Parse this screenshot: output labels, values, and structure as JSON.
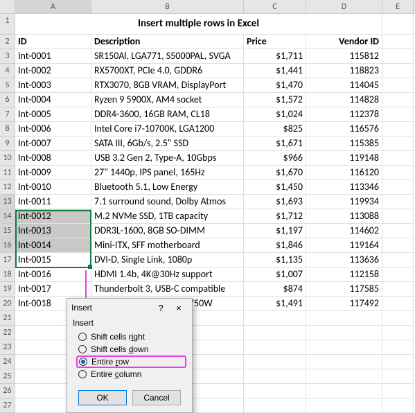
{
  "columns": [
    "A",
    "B",
    "C",
    "D",
    "E"
  ],
  "title": "Insert multiple rows in Excel",
  "headers": {
    "id": "ID",
    "desc": "Description",
    "price": "Price",
    "vendor": "Vendor ID"
  },
  "rows": [
    {
      "n": 3,
      "id": "Int-0001",
      "desc": "SR150Al, LGA771, S5000PAL, SVGA",
      "price": "$1,711",
      "vendor": "115812"
    },
    {
      "n": 4,
      "id": "Int-0002",
      "desc": "RX5700XT, PCIe 4.0, GDDR6",
      "price": "$1,441",
      "vendor": "118823"
    },
    {
      "n": 5,
      "id": "Int-0003",
      "desc": "RTX3070, 8GB VRAM, DisplayPort",
      "price": "$1,470",
      "vendor": "114045"
    },
    {
      "n": 6,
      "id": "Int-0004",
      "desc": "Ryzen 9 5900X, AM4 socket",
      "price": "$1,572",
      "vendor": "114828"
    },
    {
      "n": 7,
      "id": "Int-0005",
      "desc": "DDR4-3600, 16GB RAM, CL18",
      "price": "$1,024",
      "vendor": "112378"
    },
    {
      "n": 8,
      "id": "Int-0006",
      "desc": "Intel Core i7-10700K, LGA1200",
      "price": "$825",
      "vendor": "116576"
    },
    {
      "n": 9,
      "id": "Int-0007",
      "desc": "SATA III, 6Gb/s, 2.5\" SSD",
      "price": "$1,671",
      "vendor": "115385"
    },
    {
      "n": 10,
      "id": "Int-0008",
      "desc": "USB 3.2 Gen 2, Type-A, 10Gbps",
      "price": "$966",
      "vendor": "119148"
    },
    {
      "n": 11,
      "id": "Int-0009",
      "desc": "27\" 1440p, IPS panel, 165Hz",
      "price": "$1,670",
      "vendor": "116120"
    },
    {
      "n": 12,
      "id": "Int-0010",
      "desc": "Bluetooth 5.1, Low Energy",
      "price": "$1,450",
      "vendor": "113346"
    },
    {
      "n": 13,
      "id": "Int-0011",
      "desc": "7.1 surround sound, Dolby Atmos",
      "price": "$1,693",
      "vendor": "119934",
      "sel": true,
      "first": true
    },
    {
      "n": 14,
      "id": "Int-0012",
      "desc": "M.2 NVMe SSD, 1TB capacity",
      "price": "$1,712",
      "vendor": "113088",
      "sel": true
    },
    {
      "n": 15,
      "id": "Int-0013",
      "desc": "DDR3L-1600, 8GB SO-DIMM",
      "price": "$1,197",
      "vendor": "114602",
      "sel": true
    },
    {
      "n": 16,
      "id": "Int-0014",
      "desc": "Mini-ITX, SFF motherboard",
      "price": "$1,846",
      "vendor": "119164",
      "sel": true
    },
    {
      "n": 17,
      "id": "Int-0015",
      "desc": "DVI-D, Single Link, 1080p",
      "price": "$1,135",
      "vendor": "113636"
    },
    {
      "n": 18,
      "id": "Int-0016",
      "desc": "HDMI 1.4b, 4K@30Hz support",
      "price": "$1,007",
      "vendor": "112158"
    },
    {
      "n": 19,
      "id": "Int-0017",
      "desc": "Thunderbolt 3, USB-C compatible",
      "price": "$874",
      "vendor": "117585"
    },
    {
      "n": 20,
      "id": "Int-0018",
      "desc": "80+ Gold PSU, modular, 750W",
      "price": "$1,491",
      "vendor": "117492"
    }
  ],
  "emptyRows": [
    21,
    22,
    23,
    24,
    25,
    26,
    27
  ],
  "dialog": {
    "title": "Insert",
    "group": "Insert",
    "optRight": "Shift cells right",
    "optDown": "Shift cells down",
    "optRow": "Entire row",
    "optCol": "Entire column",
    "ok": "OK",
    "cancel": "Cancel",
    "help": "?",
    "close": "×"
  }
}
